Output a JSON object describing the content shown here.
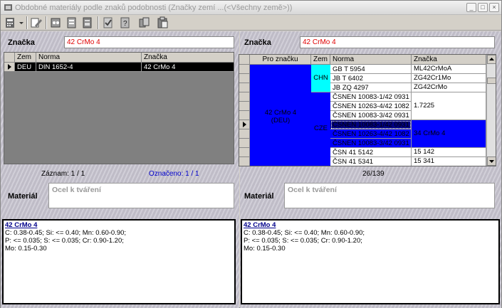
{
  "window": {
    "title": "Obdobné materiály podle znaků podobnosti (Značky zemí ...(<Všechny země>))"
  },
  "toolbar": {
    "icons": [
      "calculator-icon",
      "edit-icon",
      "cars-icon",
      "doc-icon",
      "doc2-icon",
      "check-icon",
      "help-doc-icon",
      "copy-icon",
      "paste-icon"
    ]
  },
  "left": {
    "label": "Značka",
    "value": "42 CrMo 4",
    "columns": [
      "Zem",
      "Norma",
      "Značka"
    ],
    "rows": [
      [
        "DEU",
        "DIN 1652-4",
        "42 CrMo 4"
      ]
    ],
    "status_record": "Záznam: 1 / 1",
    "status_marked": "Označeno: 1 / 1",
    "material_label": "Materiál",
    "material_placeholder": "Ocel k tváření",
    "info_title": "42 CrMo 4",
    "info_lines": [
      "C: 0.38-0.45; Si: <= 0.40; Mn: 0.60-0.90;",
      "P: <= 0.035; S: <= 0.035; Cr: 0.90-1.20;",
      "Mo: 0.15-0.30"
    ]
  },
  "right": {
    "label": "Značka",
    "value": "42 CrMo 4",
    "columns": [
      "Pro značku",
      "Zem",
      "Norma",
      "Značka"
    ],
    "group_label": "42 CrMo 4",
    "group_sub": "(DEU)",
    "zem_chn": "CHN",
    "zem_cze": "CZE",
    "norma": [
      "GB T 5954",
      "JB T 6402",
      "JB ZQ 4297",
      "ČSNEN 10083-1/42 0931",
      "ČSNEN 10263-4/42 1082",
      "ČSNEN 10083-3/42 0931",
      "ČSNEN 10083-1/42 0931",
      "ČSNEN 10263-4/42 1082",
      "ČSNEN 10083-3/42 0931",
      "ČSN 41 5142",
      "ČSN 41 5341"
    ],
    "znacka": [
      "ML42CrMoA",
      "ZG42Cr1Mo",
      "ZG42CrMo",
      "",
      "1.7225",
      "",
      "",
      "34 CrMo 4",
      "",
      "15 142",
      "15 341"
    ],
    "status": "26/139",
    "material_label": "Materiál",
    "material_placeholder": "Ocel k tváření",
    "info_title": "42 CrMo 4",
    "info_lines": [
      "C: 0.38-0.45; Si: <= 0.40; Mn: 0.60-0.90;",
      "P: <= 0.035; S: <= 0.035; Cr: 0.90-1.20;",
      "Mo: 0.15-0.30"
    ]
  },
  "colors": {
    "blue": "#0000ff",
    "cyan": "#00ffff",
    "title_text": "#9a9a9a",
    "value_red": "#e00000"
  }
}
